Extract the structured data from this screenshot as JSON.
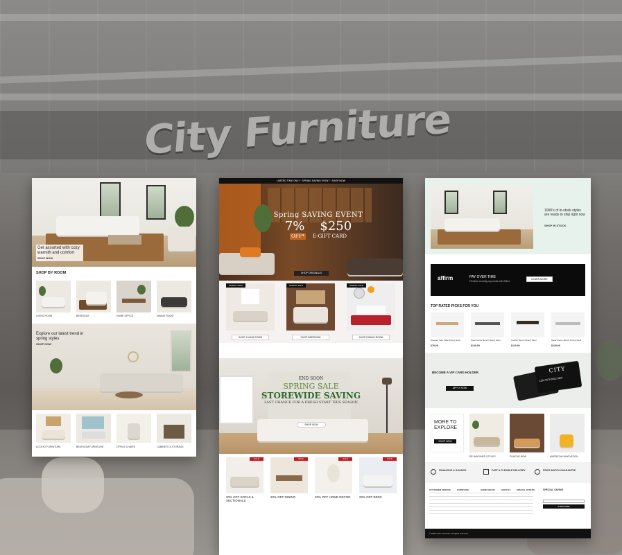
{
  "showroom": {
    "sign": "City Furniture"
  },
  "panel_left": {
    "hero_eyebrow": "",
    "hero_heading": "Get assorted with cozy warmth and comfort",
    "hero_link": "SHOP NOW",
    "section_title": "SHOP BY ROOM",
    "section_sub": "",
    "rooms": [
      "LIVING ROOM",
      "BEDROOM",
      "HOME OFFICE",
      "DINING ROOM"
    ],
    "mid_heading": "Explore our latest trend in spring styles",
    "mid_link": "SHOP NOW",
    "bottom_items": [
      "ACCENT FURNITURE",
      "BEDROOM FURNITURE",
      "OFFICE CHAIRS",
      "CABINETS & STORAGE"
    ]
  },
  "panel_center": {
    "top_bar": "LIMITED TIME ONLY · SPRING SAVING EVENT · SHOP NOW",
    "hero_line1": "Spring SAVING EVENT",
    "hero_pct": "7%",
    "hero_amount": "$250",
    "hero_off": "OFF*",
    "hero_gift": "E-GIFT CARD",
    "hero_cta": "SHOP ORIGINALS",
    "cat_tags": [
      "SPRING SALE",
      "SPRING SALE",
      "SPRING SALE"
    ],
    "cat_buttons": [
      "SHOP LIVING ROOM",
      "SHOP BEDROOM",
      "SHOP DINING ROOM"
    ],
    "banner_small": "END SOON",
    "banner_spring": "SPRING SALE",
    "banner_storewide": "STOREWIDE SAVING",
    "banner_sub": "LAST CHANCE FOR A FRESH START THIS SEASON",
    "banner_cta": "SHOP NOW",
    "deal_badges": [
      "SALE",
      "SALE",
      "SALE",
      "SALE"
    ],
    "deals": [
      "20% OFF SOFAS & SECTIONALS",
      "20% OFF DINING",
      "20% OFF HOME DECOR",
      "20% OFF BEDS"
    ]
  },
  "panel_right": {
    "hero_text": "1000's of in-stock styles are ready to ship right now",
    "hero_link": "SHOP IN STOCK",
    "affirm_logo": "affirm",
    "affirm_title": "PAY OVER TIME",
    "affirm_sub": "Flexible monthly payments with Affirm",
    "affirm_btn": "LEARN MORE",
    "picks_title": "TOP RATED PICKS FOR YOU",
    "picks": [
      {
        "name": "Wooden Side Table Dining Stool",
        "price": "$79.99"
      },
      {
        "name": "Steel Frame Bench Dining Stool",
        "price": "$149.99"
      },
      {
        "name": "Leather Bench Dining Stool",
        "price": "$119.99"
      },
      {
        "name": "Metal Frame Bench Dining Stool",
        "price": "$129.99"
      }
    ],
    "card_eyebrow": "",
    "card_title": "BECOME A VIP CARD HOLDER",
    "card_btn": "APPLY NOW",
    "card_brand": "CITY",
    "card_number": "1234 5678 9012 3456",
    "explore_title": "MORE TO EXPLORE",
    "explore_btn": "SHOP NOW",
    "explore_items": [
      "RE-IMAGINED STYLES",
      "PUNCHE NEW",
      "AMERICAN INNOVATION"
    ],
    "features": [
      "FINANCING & SAVINGS",
      "FAST & FLEXIBLE DELIVERY",
      "PRICE MATCH GUARANTEE"
    ],
    "footer_cols": [
      "CUSTOMER SERVICE",
      "FURNITURE",
      "HOME DECOR",
      "SHOP BY",
      "SPECIAL OFFERS"
    ],
    "signup_title": "SPECIAL SAVING",
    "signup_btn": "SUBSCRIBE",
    "copyright": "© 2024 CITY Furniture. All rights reserved."
  }
}
